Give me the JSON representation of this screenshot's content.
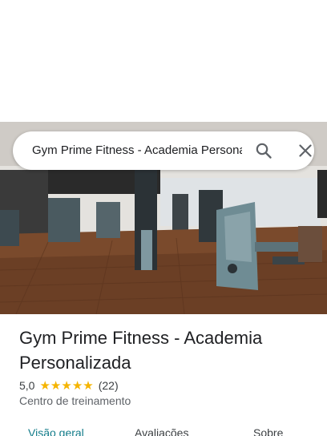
{
  "search": {
    "query": "Gym Prime Fitness - Academia Personalizada"
  },
  "place": {
    "name": "Gym Prime Fitness - Academia Personalizada",
    "rating": "5,0",
    "stars": 5,
    "reviews": "(22)",
    "category": "Centro de treinamento"
  },
  "tabs": [
    {
      "label": "Visão geral",
      "active": true
    },
    {
      "label": "Avaliações",
      "active": false
    },
    {
      "label": "Sobre",
      "active": false
    }
  ],
  "colors": {
    "accent": "#137c8a",
    "star": "#f5b400"
  },
  "icons": {
    "search": "search-icon",
    "close": "close-icon",
    "star": "star-icon"
  }
}
